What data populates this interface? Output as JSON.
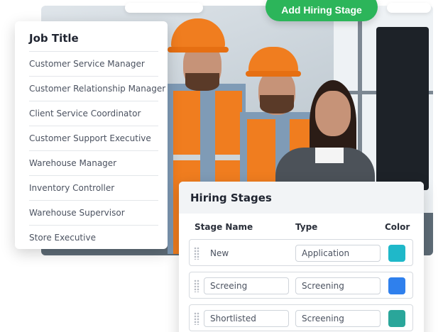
{
  "add_stage_button": {
    "label": "Add Hiring Stage",
    "color": "#2cb55a"
  },
  "job_title_panel": {
    "title": "Job Title",
    "items": [
      "Customer Service Manager",
      "Customer Relationship Manager",
      "Client Service Coordinator",
      "Customer Support Executive",
      "Warehouse Manager",
      "Inventory Controller",
      "Warehouse Supervisor",
      "Store Executive"
    ]
  },
  "hiring_stages_panel": {
    "title": "Hiring Stages",
    "columns": {
      "name": "Stage Name",
      "type": "Type",
      "color": "Color"
    },
    "rows": [
      {
        "name": "New",
        "type": "Application",
        "color": "#1fb8c9"
      },
      {
        "name": "Screeing",
        "type": "Screening",
        "color": "#2f80ed"
      },
      {
        "name": "Shortlisted",
        "type": "Screening",
        "color": "#2aa69a"
      }
    ]
  }
}
